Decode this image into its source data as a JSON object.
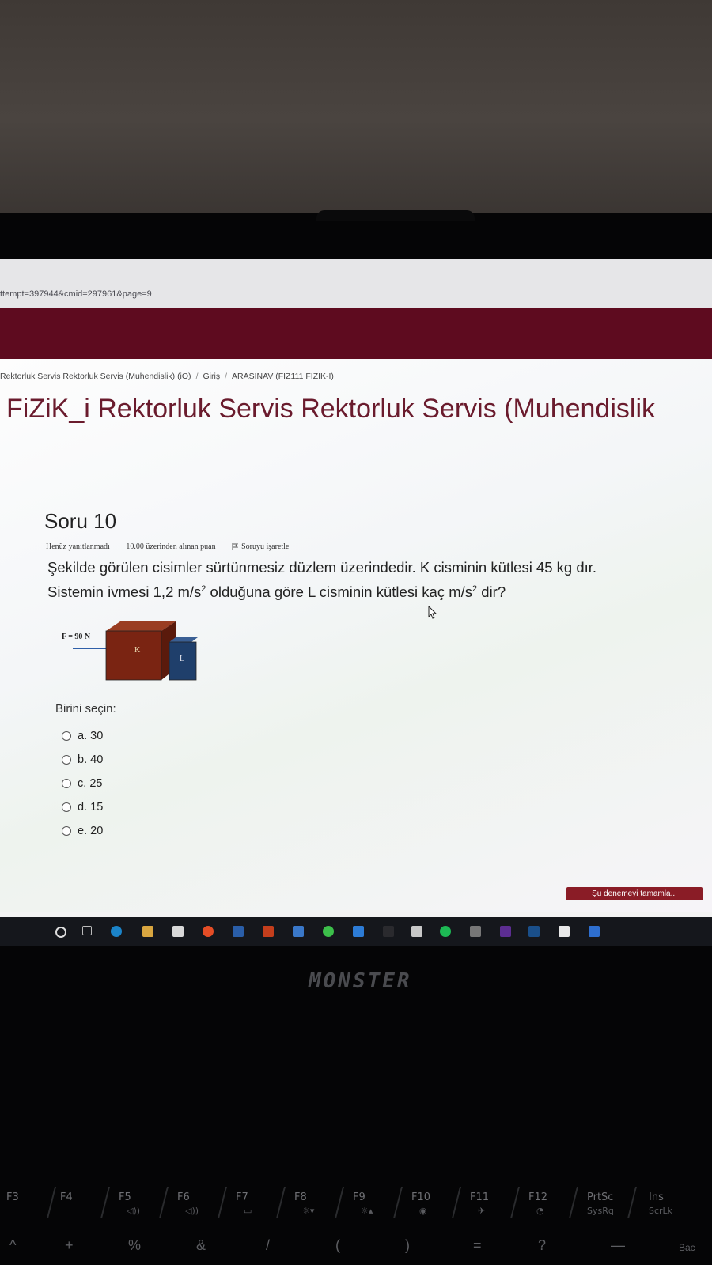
{
  "browser": {
    "url_fragment": "ttempt=397944&cmid=297961&page=9"
  },
  "breadcrumb": [
    "Rektorluk Servis Rektorluk Servis (Muhendislik) (iO)",
    "Giriş",
    "ARASINAV (FİZ111 FİZİK-I)"
  ],
  "page_title": "FiZiK_i Rektorluk Servis Rektorluk Servis (Muhendislik",
  "question": {
    "title": "Soru 10",
    "status": "Henüz yanıtlanmadı",
    "points": "10.00 üzerinden alınan puan",
    "flag_label": "Soruyu işaretle",
    "text_line1": "Şekilde görülen cisimler sürtünmesiz düzlem üzerindedir. K cisminin kütlesi 45 kg dır.",
    "text_line2_a": "Sistemin ivmesi 1,2 m/s",
    "text_line2_sup": "2",
    "text_line2_b": " olduğuna göre L cisminin kütlesi kaç m/s",
    "text_line2_sup2": "2",
    "text_line2_c": " dir?",
    "figure": {
      "force_label": "F = 90 N",
      "block_k": "K",
      "block_l": "L",
      "block_k_color": "#7a2412",
      "block_l_color": "#1f3f6b"
    },
    "choose_label": "Birini seçin:",
    "options": [
      {
        "letter": "a.",
        "value": "30"
      },
      {
        "letter": "b.",
        "value": "40"
      },
      {
        "letter": "c.",
        "value": "25"
      },
      {
        "letter": "d.",
        "value": "15"
      },
      {
        "letter": "e.",
        "value": "20"
      }
    ],
    "finish_button": "Şu denemeyi tamamla..."
  },
  "colors": {
    "brand": "#5e0b1f",
    "title": "#6a1b2d",
    "button": "#8a1c26"
  },
  "taskbar_icons": [
    "start-icon",
    "task-view-icon",
    "edge-icon",
    "file-explorer-icon",
    "store-icon",
    "chrome-icon",
    "app-icon",
    "office-icon",
    "mail-icon",
    "whatsapp-icon",
    "check-icon",
    "app-icon",
    "calculator-icon",
    "spotify-icon",
    "app-icon",
    "visual-studio-icon",
    "app-icon",
    "app-icon",
    "app-icon"
  ],
  "laptop": {
    "brand": "MONSTER",
    "fn_keys": [
      {
        "label": "F3",
        "sub": ""
      },
      {
        "label": "F4",
        "sub": ""
      },
      {
        "label": "F5",
        "sub": "◁))"
      },
      {
        "label": "F6",
        "sub": "◁))"
      },
      {
        "label": "F7",
        "sub": "▭"
      },
      {
        "label": "F8",
        "sub": "☼▾"
      },
      {
        "label": "F9",
        "sub": "☼▴"
      },
      {
        "label": "F10",
        "sub": "◉"
      },
      {
        "label": "F11",
        "sub": "✈"
      },
      {
        "label": "F12",
        "sub": "◔"
      },
      {
        "label": "PrtSc",
        "sub": "SysRq"
      },
      {
        "label": "Ins",
        "sub": "ScrLk"
      }
    ],
    "num_keys": [
      "^",
      "+",
      "%",
      "&",
      "/",
      "(",
      ")",
      "=",
      "?",
      "—",
      "Bac"
    ]
  }
}
